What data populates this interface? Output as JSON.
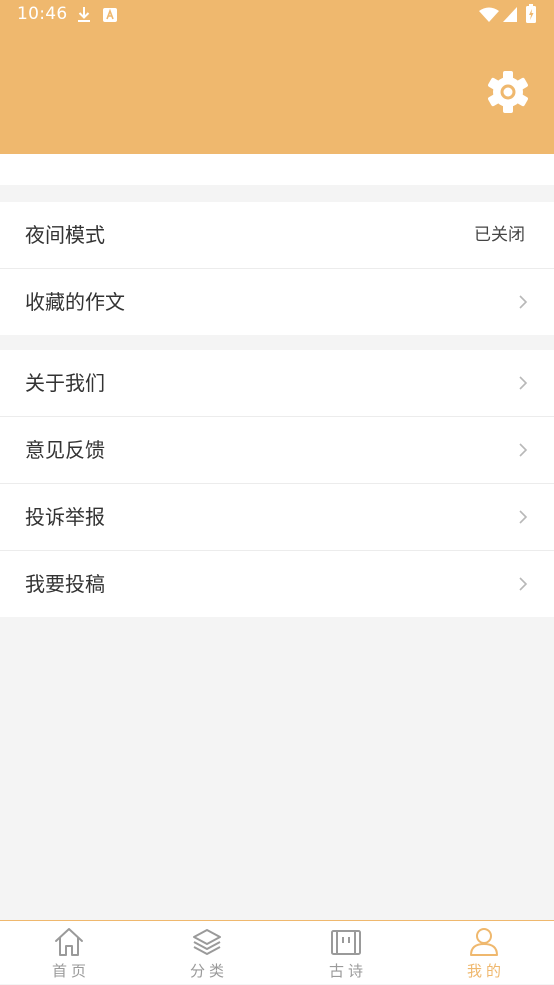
{
  "status_bar": {
    "time": "10:46",
    "icons": [
      "download-icon",
      "a-letter-icon",
      "wifi-icon",
      "signal-icon",
      "battery-charging-icon"
    ]
  },
  "header": {
    "background_color": "#efb86e",
    "settings_icon": "gear-icon"
  },
  "menu_groups": [
    {
      "items": [
        {
          "label": "夜间模式",
          "value": "已关闭"
        },
        {
          "label": "收藏的作文"
        }
      ]
    },
    {
      "items": [
        {
          "label": "关于我们"
        },
        {
          "label": "意见反馈"
        },
        {
          "label": "投诉举报"
        },
        {
          "label": "我要投稿"
        }
      ]
    }
  ],
  "tab_bar": {
    "items": [
      {
        "label": "首页",
        "icon": "home-icon"
      },
      {
        "label": "分类",
        "icon": "layers-icon"
      },
      {
        "label": "古诗",
        "icon": "scroll-icon"
      },
      {
        "label": "我的",
        "icon": "user-icon",
        "active": true
      }
    ],
    "active_color": "#efb86e",
    "inactive_color": "#9a9a9a"
  }
}
